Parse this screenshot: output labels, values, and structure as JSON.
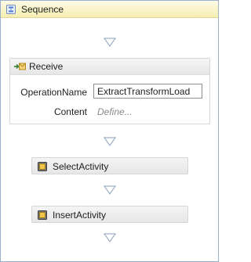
{
  "sequence": {
    "title": "Sequence",
    "icon": "sequence-icon"
  },
  "receive": {
    "title": "Receive",
    "icon": "receive-icon",
    "operation_label": "OperationName",
    "operation_value": "ExtractTransformLoad",
    "content_label": "Content",
    "content_placeholder": "Define..."
  },
  "activities": [
    {
      "label": "SelectActivity",
      "icon": "activity-icon"
    },
    {
      "label": "InsertActivity",
      "icon": "activity-icon"
    }
  ],
  "colors": {
    "header_bg": "#f6eeb2",
    "border": "#9ab0c9",
    "arrow": "#9fb0c4",
    "define_text": "#8a8a8a"
  }
}
